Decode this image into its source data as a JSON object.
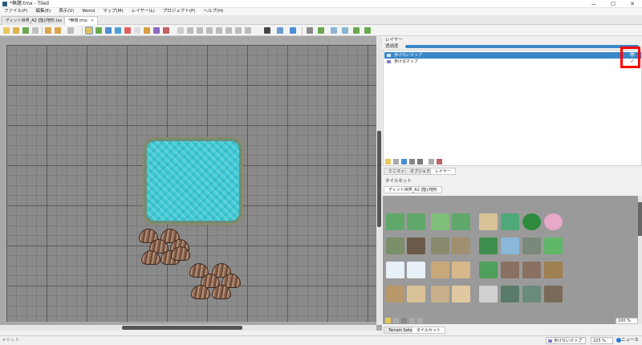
{
  "window": {
    "title": "*無題.tmx - Tiled",
    "minimize": "—",
    "maximize": "☐",
    "close": "✕"
  },
  "menu": [
    "ファイル(F)",
    "編集(E)",
    "表示(V)",
    "World",
    "マップ(M)",
    "レイヤー(L)",
    "プロジェクト(P)",
    "ヘルプ(H)"
  ],
  "tabs": [
    {
      "label": "ディット世界_A2 (陸)/地形.tsx"
    },
    {
      "label": "*無題.tmx"
    }
  ],
  "tab_close": "×",
  "layers_panel": {
    "title": "レイヤー",
    "opacity_label": "透過度",
    "layers": [
      {
        "name": "歩けないマップ",
        "selected": true
      },
      {
        "name": "歩けるマップ",
        "selected": false
      }
    ]
  },
  "bottom_tabs": [
    "ミニマップ",
    "オブジェクト",
    "レイヤー"
  ],
  "tileset_panel": {
    "title": "タイルセット",
    "tab": "ディット世界_A2 (陸)/地形"
  },
  "tileset_zoom": "100 %",
  "tileset_tabs": [
    "Terrain Sets",
    "タイルセット"
  ],
  "status": {
    "layer_select": "歩けないマップ",
    "zoom": "225 %",
    "news": "ニュース",
    "left_icons": "⊗ 0   ⚠ 0"
  },
  "colors": {
    "water": "#3cc8d4",
    "selection": "#3a86c8",
    "highlight": "#ff0000"
  }
}
